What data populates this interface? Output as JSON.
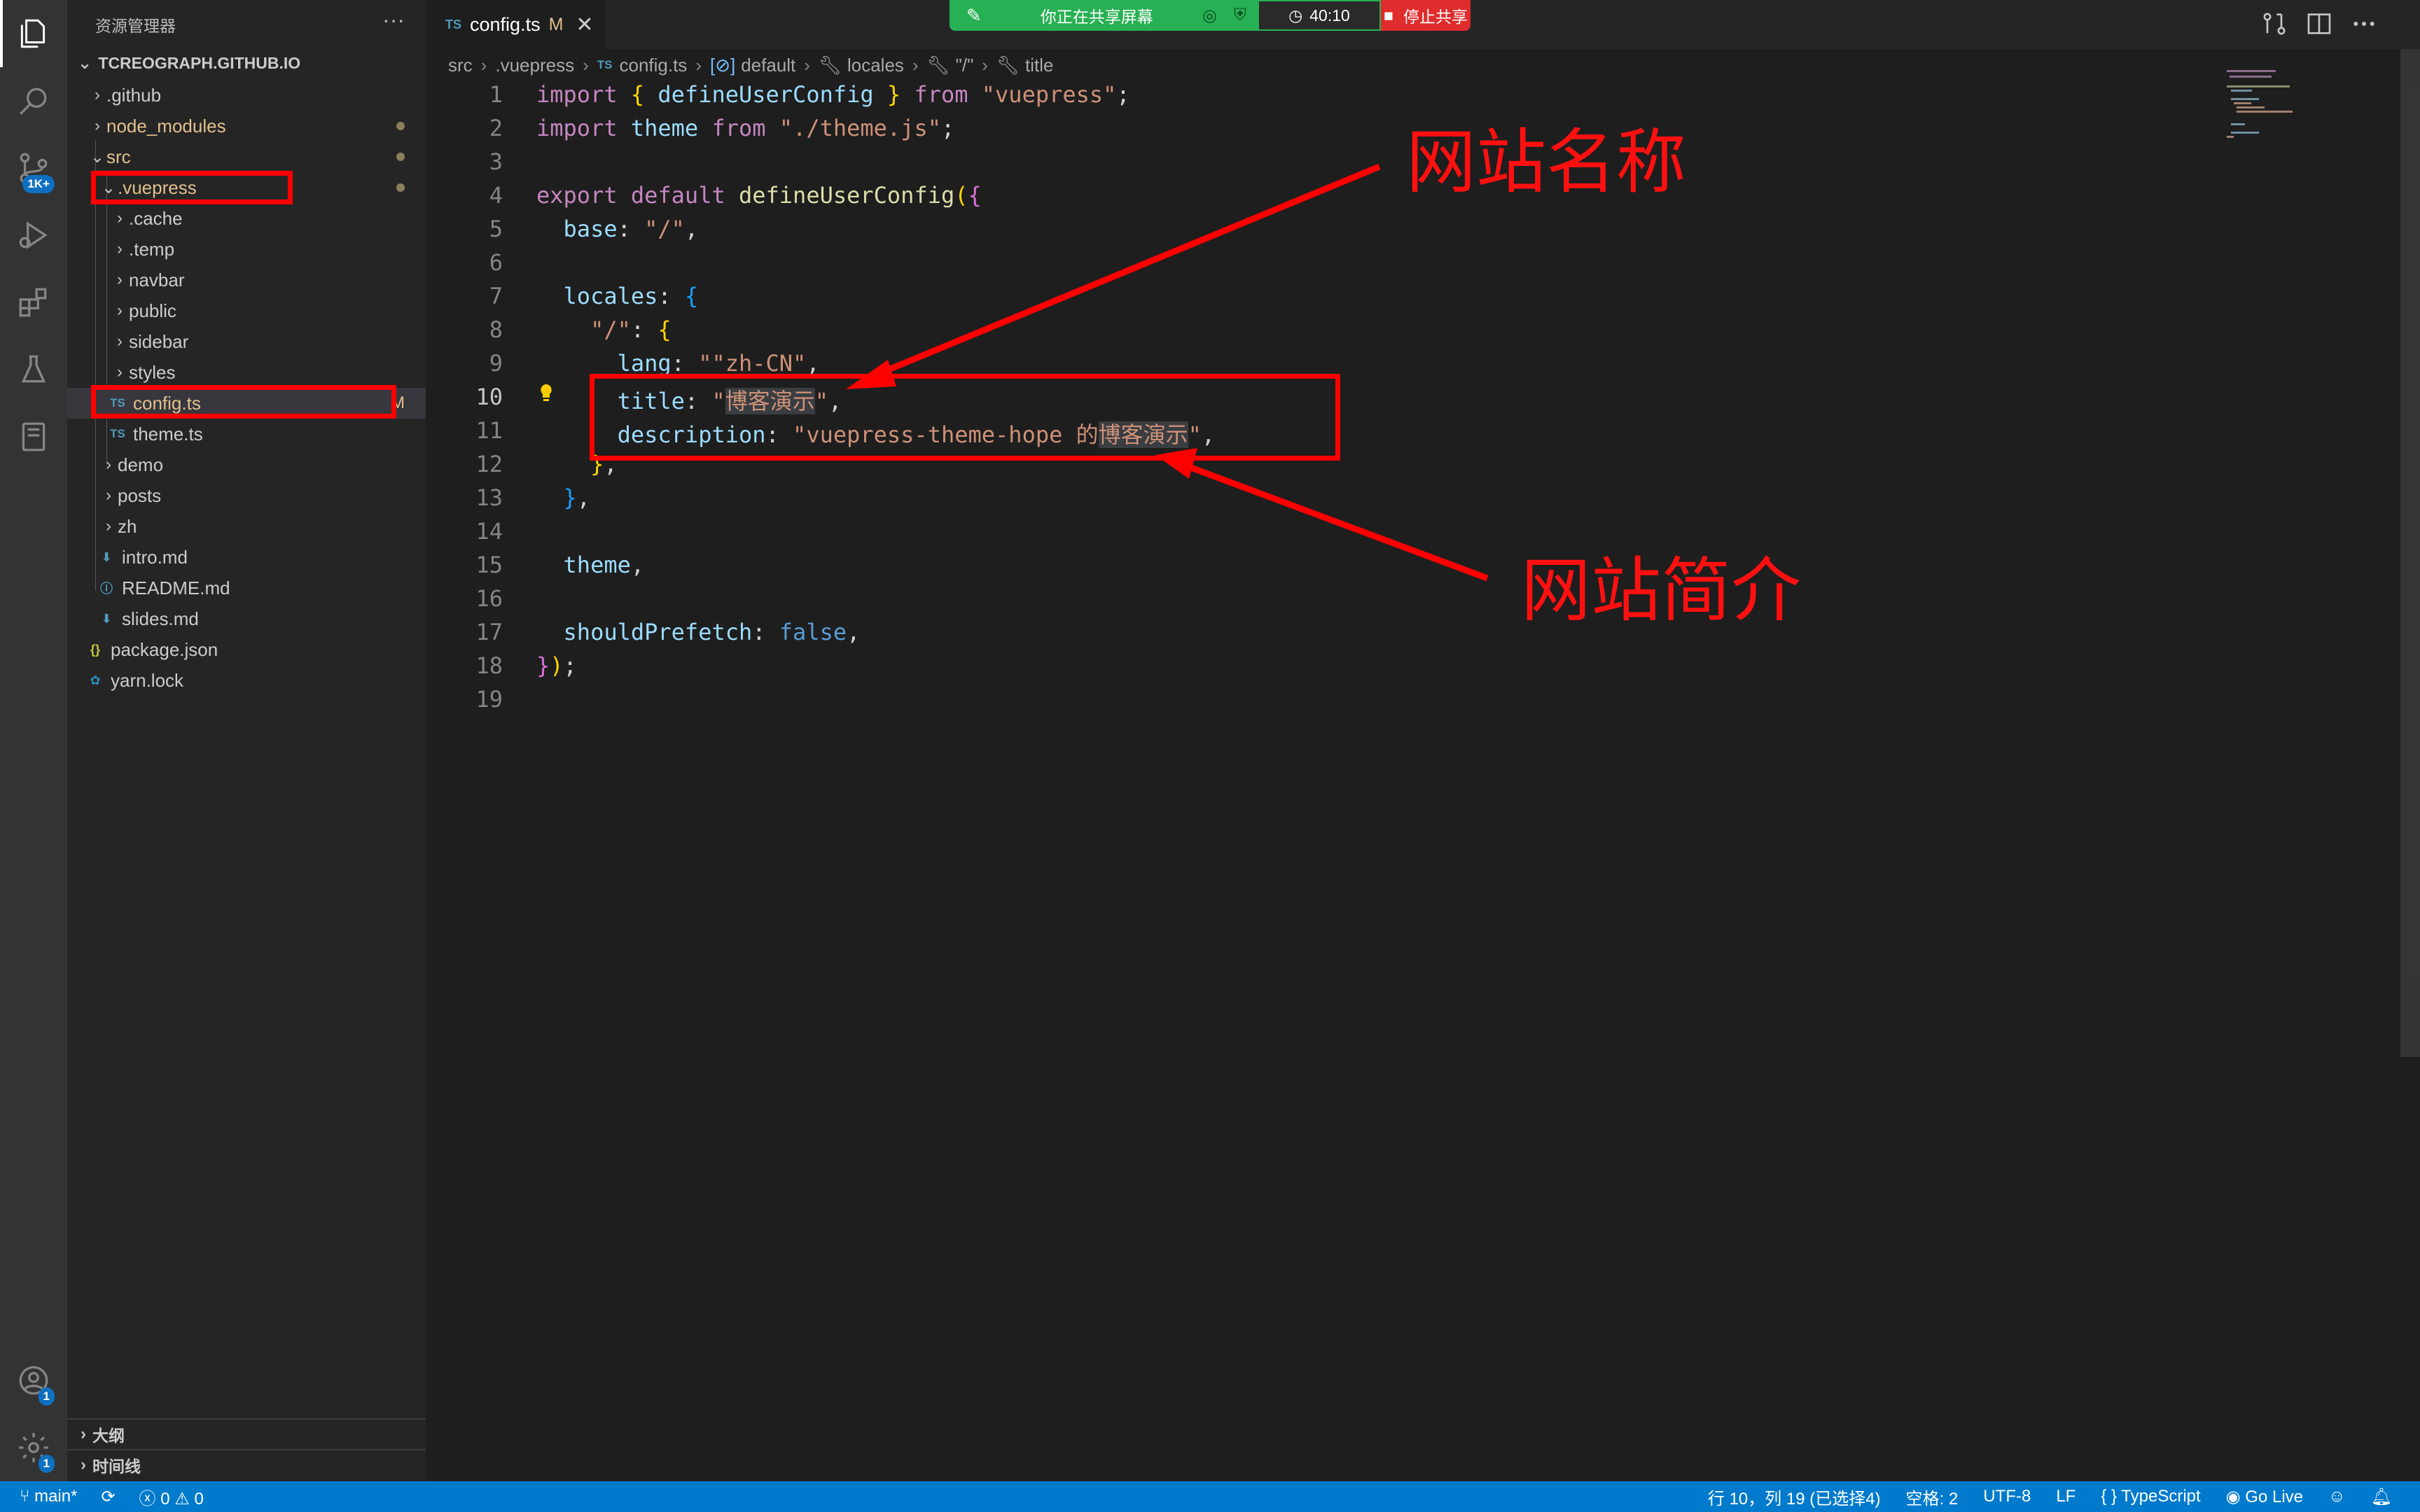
{
  "explorer": {
    "title": "资源管理器",
    "more": "···",
    "folder": "TCREOGRAPH.GITHUB.IO",
    "tree": [
      {
        "label": ".github"
      },
      {
        "label": "node_modules"
      },
      {
        "label": "src"
      },
      {
        "label": ".vuepress"
      },
      {
        "label": ".cache"
      },
      {
        "label": ".temp"
      },
      {
        "label": "navbar"
      },
      {
        "label": "public"
      },
      {
        "label": "sidebar"
      },
      {
        "label": "styles"
      },
      {
        "label": "config.ts",
        "badge": "M"
      },
      {
        "label": "theme.ts"
      },
      {
        "label": "demo"
      },
      {
        "label": "posts"
      },
      {
        "label": "zh"
      },
      {
        "label": "intro.md"
      },
      {
        "label": "README.md"
      },
      {
        "label": "slides.md"
      },
      {
        "label": "package.json"
      },
      {
        "label": "yarn.lock"
      }
    ],
    "outline": "大纲",
    "timeline": "时间线"
  },
  "activity": {
    "scm_badge": "1K+",
    "accounts_badge": "1",
    "settings_badge": "1"
  },
  "tab": {
    "lang": "TS",
    "name": "config.ts",
    "modified": "M",
    "close": "✕"
  },
  "share": {
    "text": "你正在共享屏幕",
    "timer": "40:10",
    "stop": "停止共享"
  },
  "breadcrumb": {
    "items": [
      "src",
      ".vuepress",
      "config.ts",
      "default",
      "locales",
      "\"/\"",
      "title"
    ]
  },
  "editor": {
    "line_numbers": [
      "1",
      "2",
      "3",
      "4",
      "5",
      "6",
      "7",
      "8",
      "9",
      "10",
      "11",
      "12",
      "13",
      "14",
      "15",
      "16",
      "17",
      "18",
      "19"
    ],
    "current_line": "10",
    "strings": {
      "vuepress": "\"vuepress\"",
      "theme_path": "\"./theme.js\"",
      "base": "\"/\"",
      "root_key": "\"/\"",
      "lang": "\"zh-CN\"",
      "title_val": "博客演示",
      "desc_prefix": "\"vuepress-theme-hope 的",
      "desc_hl": "博客演示",
      "desc_suffix": "\""
    }
  },
  "annotations": {
    "site_name": "网站名称",
    "site_desc": "网站简介",
    "color": "#ff0000"
  },
  "status": {
    "branch": "main*",
    "errors": "0",
    "warnings": "0",
    "position": "行 10，列 19 (已选择4)",
    "spaces": "空格: 2",
    "encoding": "UTF-8",
    "eol": "LF",
    "language": "TypeScript",
    "golive": "Go Live",
    "accent": "#007acc"
  }
}
